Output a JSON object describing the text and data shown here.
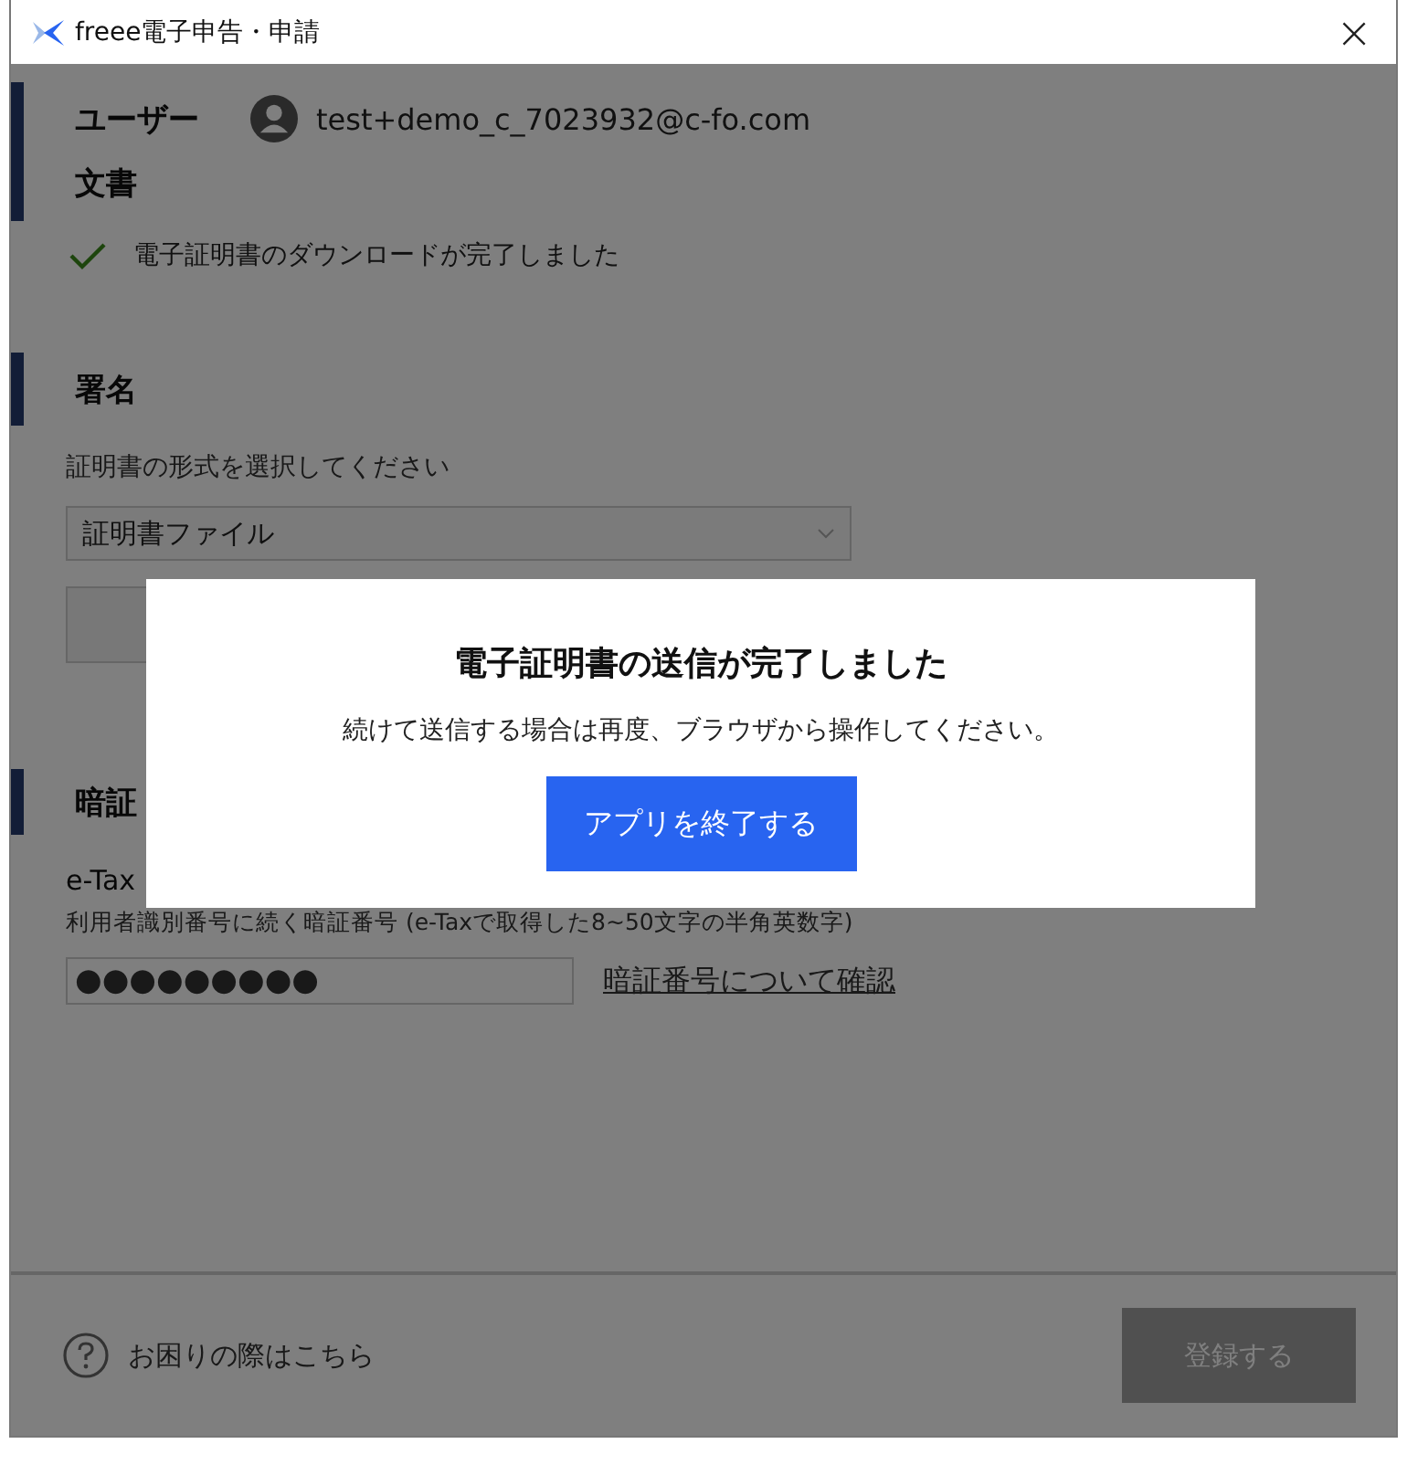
{
  "window": {
    "title": "freee電子申告・申請",
    "close": "×"
  },
  "user": {
    "label": "ユーザー",
    "email": "test+demo_c_7023932@c-fo.com"
  },
  "document": {
    "heading": "文書",
    "status": "電子証明書のダウンロードが完了しました",
    "done": true
  },
  "signature": {
    "heading": "署名",
    "prompt": "証明書の形式を選択してください",
    "select_value": "証明書ファイル"
  },
  "pin": {
    "heading": "暗証",
    "label": "e-Tax",
    "hint": "利用者識別番号に続く暗証番号 (e-Taxで取得した8~50文字の半角英数字)",
    "value": "●●●●●●●●●",
    "link": "暗証番号について確認"
  },
  "footer": {
    "help": "お困りの際はこちら",
    "submit": {
      "label": "登録する",
      "disabled": true
    }
  },
  "dialog": {
    "title": "電子証明書の送信が完了しました",
    "message": "続けて送信する場合は再度、ブラウザから操作してください。",
    "button": "アプリを終了する"
  }
}
